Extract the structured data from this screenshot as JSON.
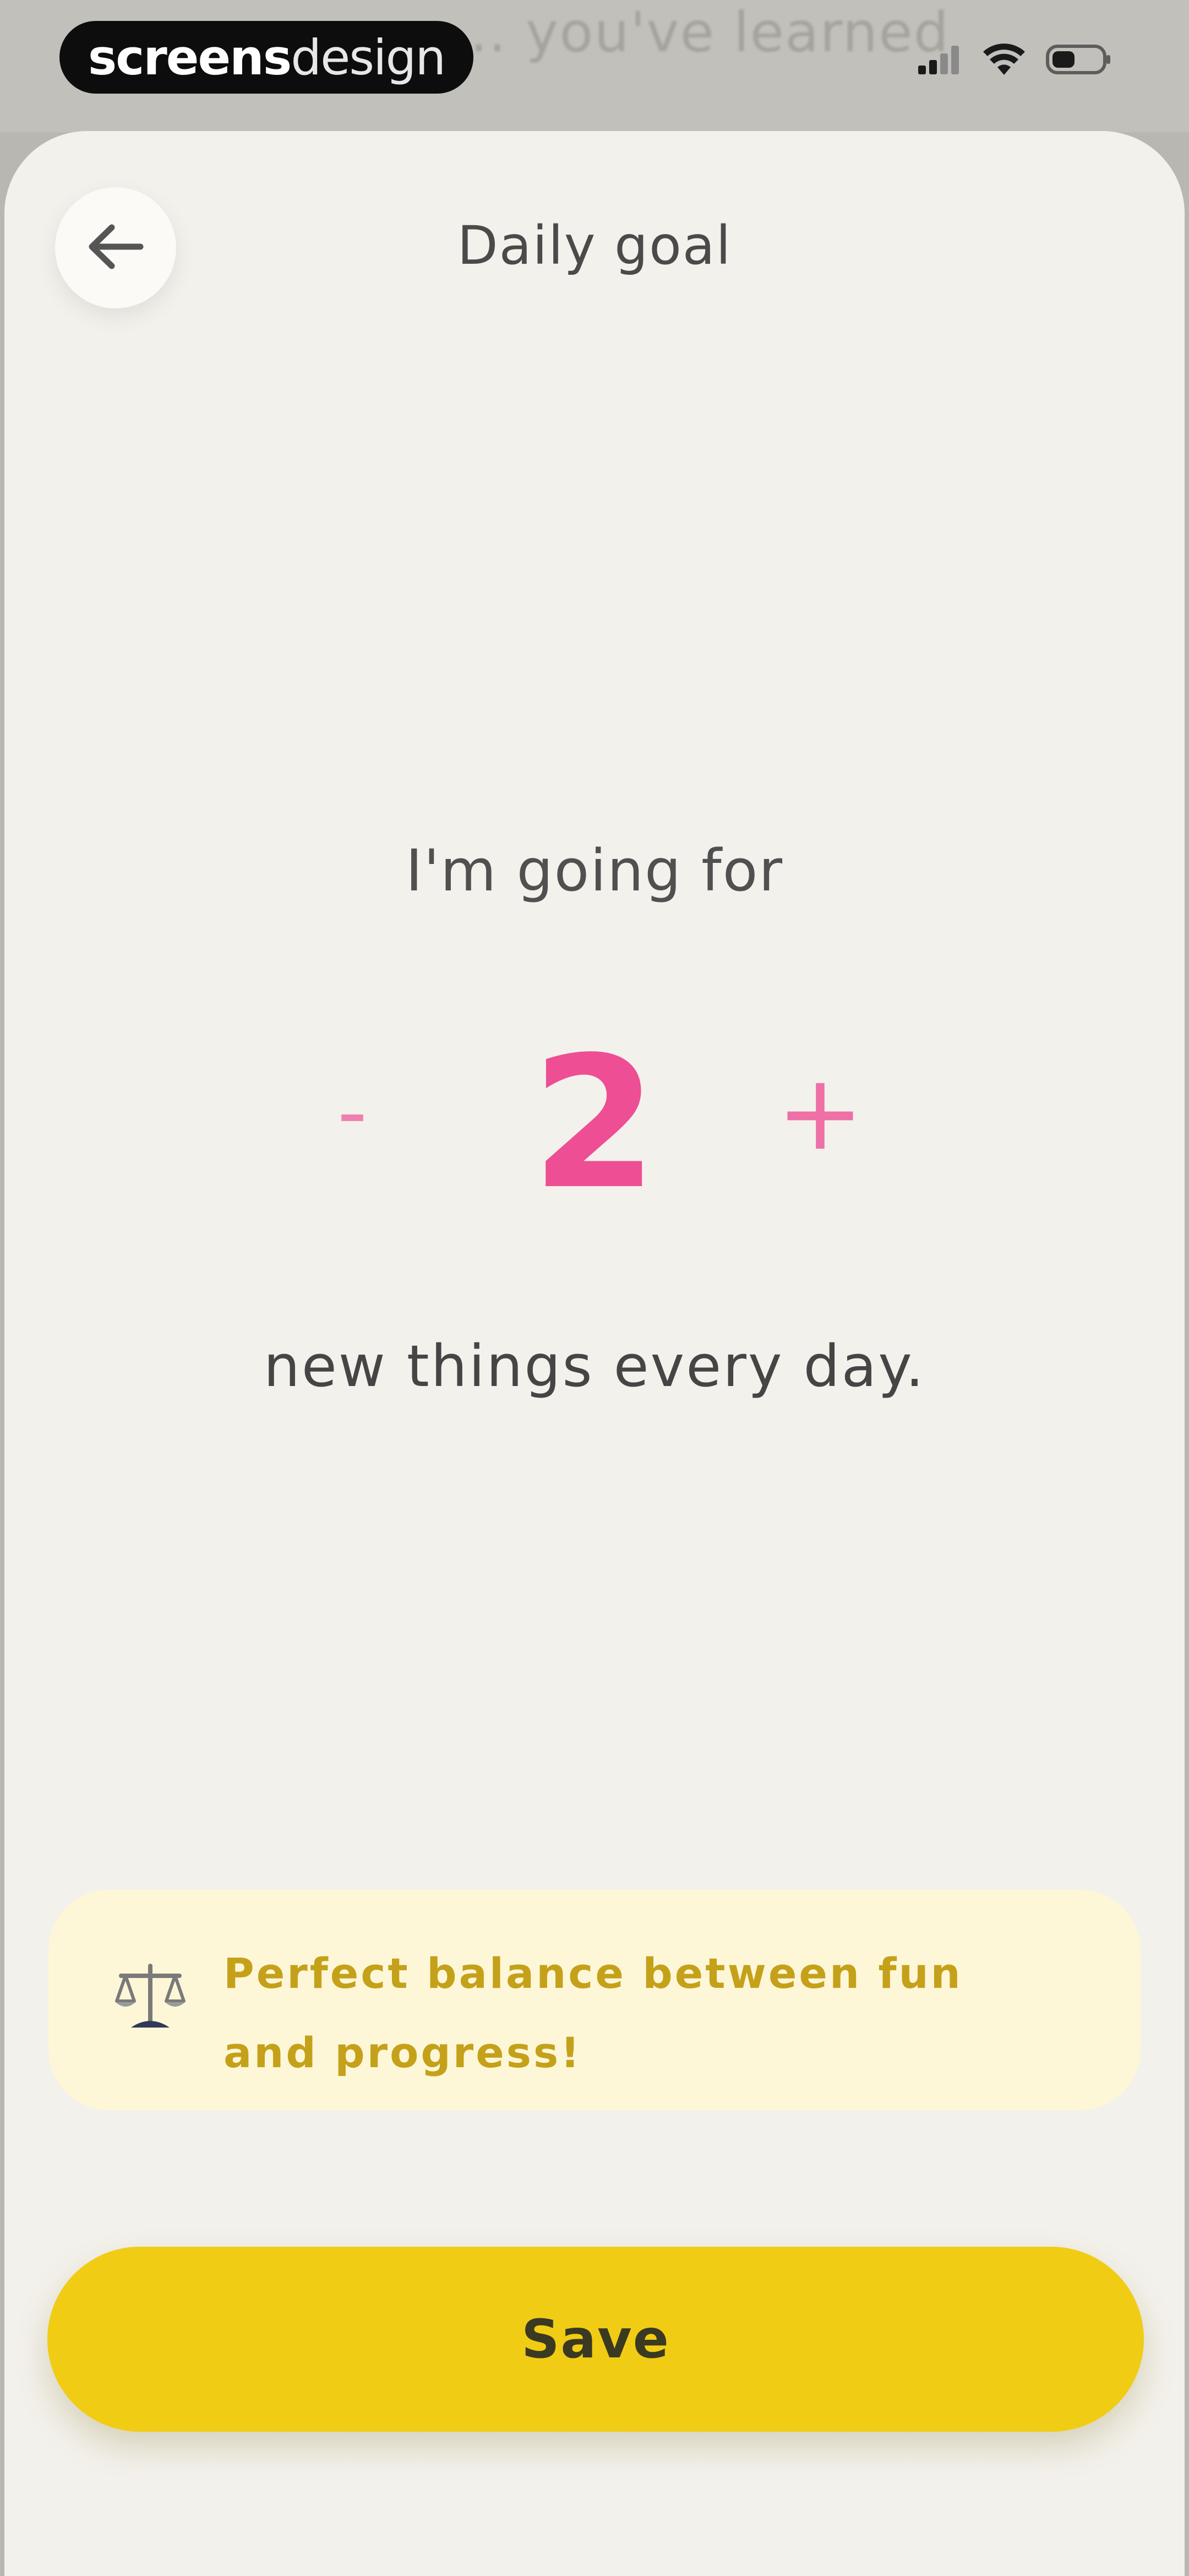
{
  "status_bar": {
    "brand_bold": "screens",
    "brand_light": "design",
    "background_text": "... you've learned"
  },
  "header": {
    "title": "Daily goal",
    "back_icon": "arrow-left-icon"
  },
  "goal": {
    "prefix_text": "I'm going for",
    "decrement_label": "-",
    "value": "2",
    "increment_label": "+",
    "suffix_text": "new things every day."
  },
  "tip": {
    "icon": "balance-scale-icon",
    "text": "Perfect balance between fun and progress!"
  },
  "actions": {
    "save_label": "Save"
  },
  "colors": {
    "accent_pink": "#ee4e93",
    "accent_yellow": "#f1cc14",
    "tip_background": "#fdf7d8",
    "tip_text": "#c5a11a",
    "sheet_background": "#f3f1eb"
  }
}
